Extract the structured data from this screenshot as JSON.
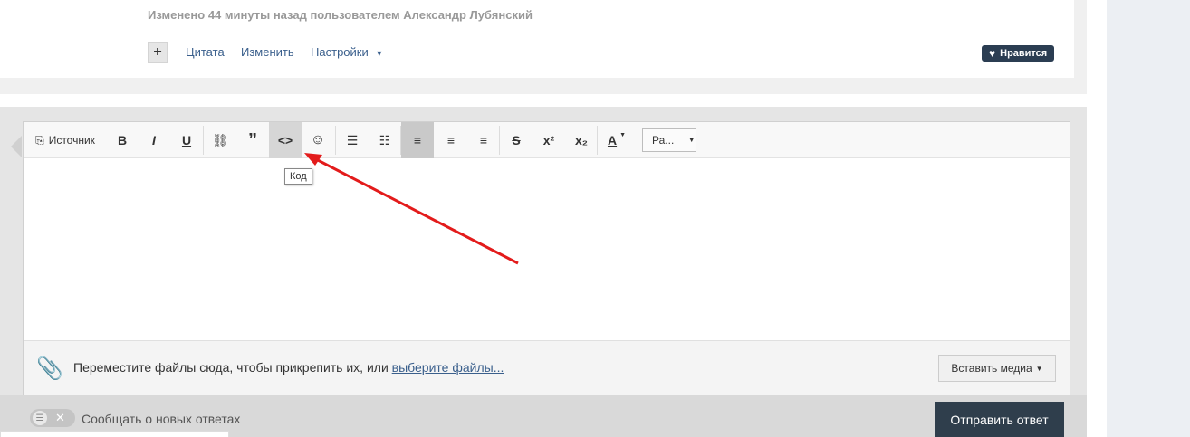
{
  "post": {
    "edited_text": "Изменено 44 минуты назад пользователем Александр Лубянский",
    "actions": {
      "plus": "+",
      "quote": "Цитата",
      "edit": "Изменить",
      "settings": "Настройки"
    },
    "like_label": "Нравится"
  },
  "editor": {
    "toolbar": {
      "source": "Источник",
      "tooltip": "Код",
      "format_value": "Ра..."
    },
    "attach": {
      "text": "Переместите файлы сюда, чтобы прикрепить их, или ",
      "link": "выберите файлы...",
      "insert_media": "Вставить медиа"
    }
  },
  "footer": {
    "notify_label": "Сообщать о новых ответах",
    "submit": "Отправить ответ"
  },
  "colors": {
    "link": "#3a5f8c",
    "like_bg": "#2b3d52",
    "submit_bg": "#2f3e4c",
    "annotation_arrow": "#e31b1b"
  }
}
